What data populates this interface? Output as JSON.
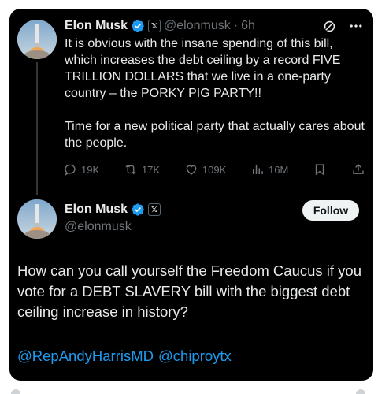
{
  "context_tweet": {
    "author_name": "Elon Musk",
    "handle": "@elonmusk",
    "separator": "·",
    "time": "6h",
    "body_p1": "It is obvious with the insane spending of this bill, which increases the debt ceiling by a record FIVE TRILLION DOLLARS that we live in a one-party country – the PORKY PIG PARTY!!",
    "body_p2": "Time for a new political party that actually cares about the people.",
    "metrics": {
      "replies": "19K",
      "reposts": "17K",
      "likes": "109K",
      "views": "16M"
    },
    "icons": {
      "grok": "grok-icon",
      "more": "more-icon",
      "reply": "reply-icon",
      "repost": "repost-icon",
      "like": "heart-icon",
      "views": "views-icon",
      "bookmark": "bookmark-icon",
      "share": "share-icon"
    }
  },
  "main_tweet": {
    "author_name": "Elon Musk",
    "handle": "@elonmusk",
    "follow_label": "Follow",
    "body": "How can you call yourself the Freedom Caucus if you vote for a DEBT SLAVERY bill with the biggest debt ceiling increase in history?",
    "mentions": [
      "@RepAndyHarrisMD",
      "@chiproytx"
    ]
  },
  "badges": {
    "verified_icon": "verified-badge-icon",
    "affiliate_label": "𝕏"
  },
  "colors": {
    "background": "#000000",
    "text": "#e7e9ea",
    "secondary": "#71767b",
    "link": "#1d9bf0",
    "verified": "#1d9bf0"
  }
}
